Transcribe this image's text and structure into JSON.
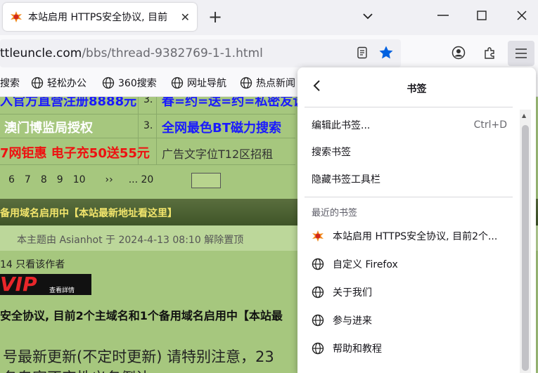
{
  "tab": {
    "title": "本站启用 HTTPS安全协议, 目前",
    "close_label": "✕"
  },
  "new_tab_label": "+",
  "address": {
    "host": "ttleuncle.com",
    "path": "/bbs/thread-9382769-1-1.html"
  },
  "bookmarks_toolbar": [
    {
      "label": "搜索",
      "icon": "globe-icon"
    },
    {
      "label": "轻松办公",
      "icon": "globe-icon"
    },
    {
      "label": "360搜索",
      "icon": "globe-icon"
    },
    {
      "label": "网址导航",
      "icon": "globe-icon"
    },
    {
      "label": "热点新闻",
      "icon": "globe-icon"
    }
  ],
  "page": {
    "ad_rows": [
      {
        "left": "入官方直营注册8888元",
        "num": "3.",
        "right": "春=约=送=约=私密友谈"
      },
      {
        "left": "澳门博监局授权",
        "num": "3.",
        "right": "全网最色BT磁力搜索"
      },
      {
        "left": "7网钜惠 电子充50送55元",
        "num": "",
        "right": "广告文字位T12区招租"
      }
    ],
    "pager": [
      "6",
      "7",
      "8",
      "9",
      "10",
      "››",
      "... 20"
    ],
    "dark_bar": "备用域名启用中【本站最新地址看这里】",
    "sticky_note": "本主题由 Asianhot 于 2024-4-13 08:10 解除置顶",
    "meta": "14  只看该作者",
    "vip_text": "VIP",
    "vip_sub": "查看詳情",
    "headline": "安全协议, 目前2个主域名和1个备用域名启用中【本站最",
    "body_line1": "号最新更新(不定时更新) 请特别注意，23",
    "body_line2": "各专家不定性义务倒让"
  },
  "panel": {
    "title": "书签",
    "actions": [
      {
        "label": "编辑此书签...",
        "shortcut": "Ctrl+D"
      },
      {
        "label": "搜索书签",
        "shortcut": ""
      },
      {
        "label": "隐藏书签工具栏",
        "shortcut": ""
      }
    ],
    "recent_label": "最近的书签",
    "recent": [
      {
        "label": "本站启用 HTTPS安全协议, 目前2个...",
        "icon": "site-favicon-icon"
      },
      {
        "label": "自定义 Firefox",
        "icon": "globe-icon"
      },
      {
        "label": "关于我们",
        "icon": "globe-icon"
      },
      {
        "label": "参与进来",
        "icon": "globe-icon"
      },
      {
        "label": "帮助和教程",
        "icon": "globe-icon"
      }
    ]
  },
  "colors": {
    "page_bg": "#a6c77e",
    "ad_blue": "#1a1aff",
    "ad_red": "#ee1111",
    "ad_white": "#ffffff",
    "star_blue": "#0061e0",
    "dark_bar_text": "#f2e56c"
  }
}
